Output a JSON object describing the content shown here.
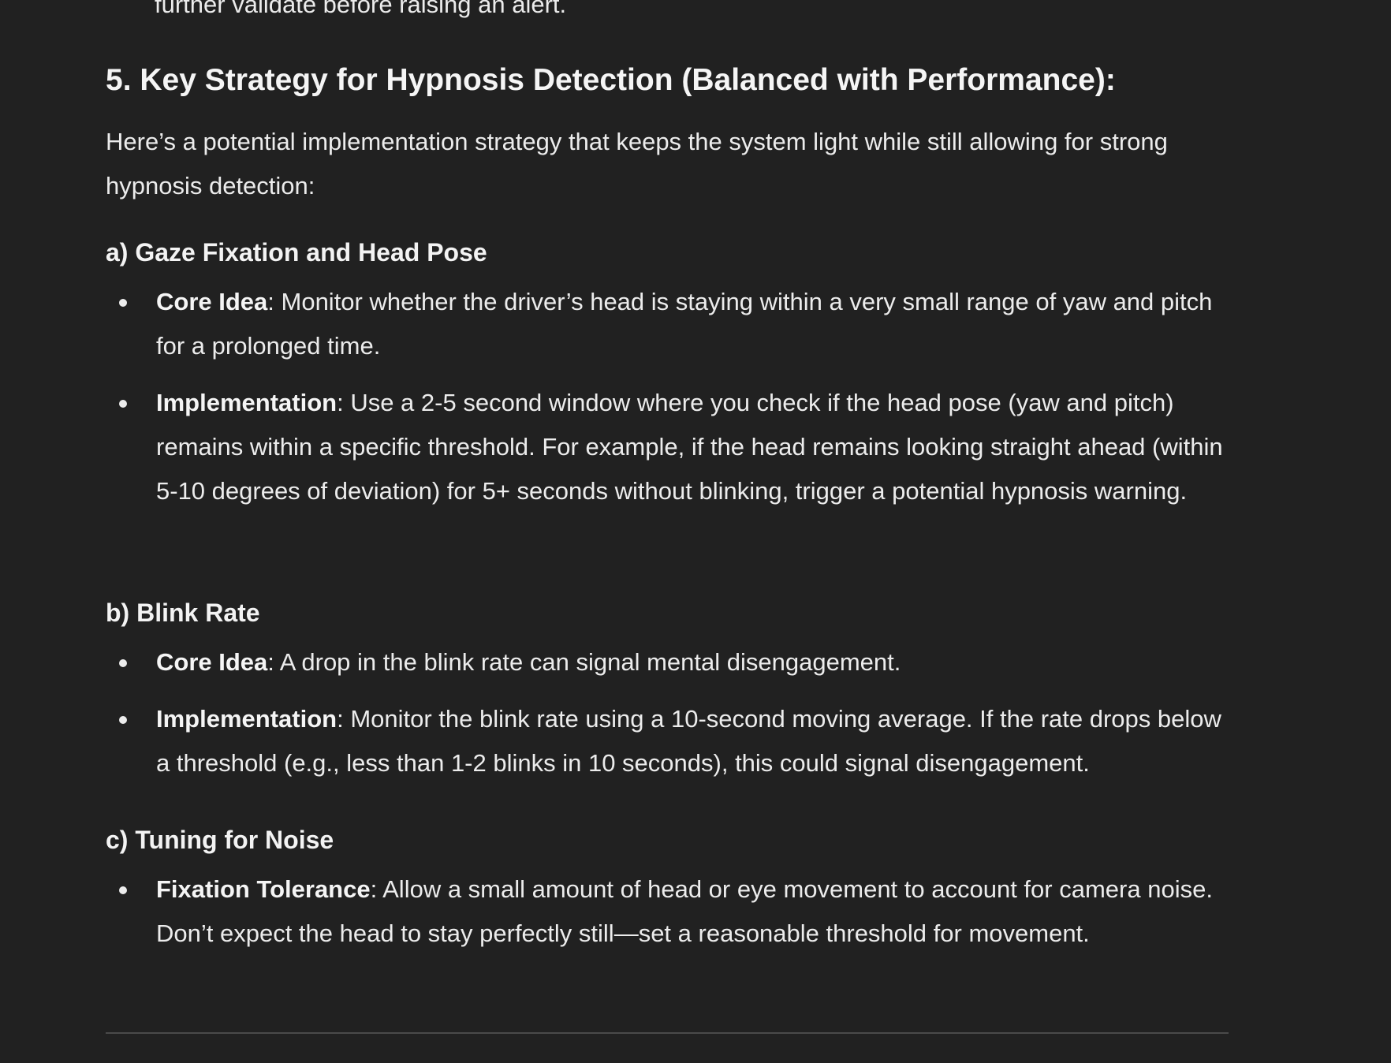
{
  "cutoff_text": "further validate before raising an alert.",
  "section": {
    "title": "5. Key Strategy for Hypnosis Detection (Balanced with Performance):",
    "intro": "Here’s a potential implementation strategy that keeps the system light while still allowing for strong hypnosis detection:"
  },
  "subsections": [
    {
      "heading": "a) Gaze Fixation and Head Pose",
      "items": [
        {
          "term": "Core Idea",
          "text": ": Monitor whether the driver’s head is staying within a very small range of yaw and pitch for a prolonged time."
        },
        {
          "term": "Implementation",
          "text": ": Use a 2-5 second window where you check if the head pose (yaw and pitch) remains within a specific threshold. For example, if the head remains looking straight ahead (within 5-10 degrees of deviation) for 5+ seconds without blinking, trigger a potential hypnosis warning."
        }
      ]
    },
    {
      "heading": "b) Blink Rate",
      "items": [
        {
          "term": "Core Idea",
          "text": ": A drop in the blink rate can signal mental disengagement."
        },
        {
          "term": "Implementation",
          "text": ": Monitor the blink rate using a 10-second moving average. If the rate drops below a threshold (e.g., less than 1-2 blinks in 10 seconds), this could signal disengagement."
        }
      ]
    },
    {
      "heading": "c) Tuning for Noise",
      "items": [
        {
          "term": "Fixation Tolerance",
          "text": ": Allow a small amount of head or eye movement to account for camera noise. Don’t expect the head to stay perfectly still—set a reasonable threshold for movement."
        }
      ]
    }
  ]
}
